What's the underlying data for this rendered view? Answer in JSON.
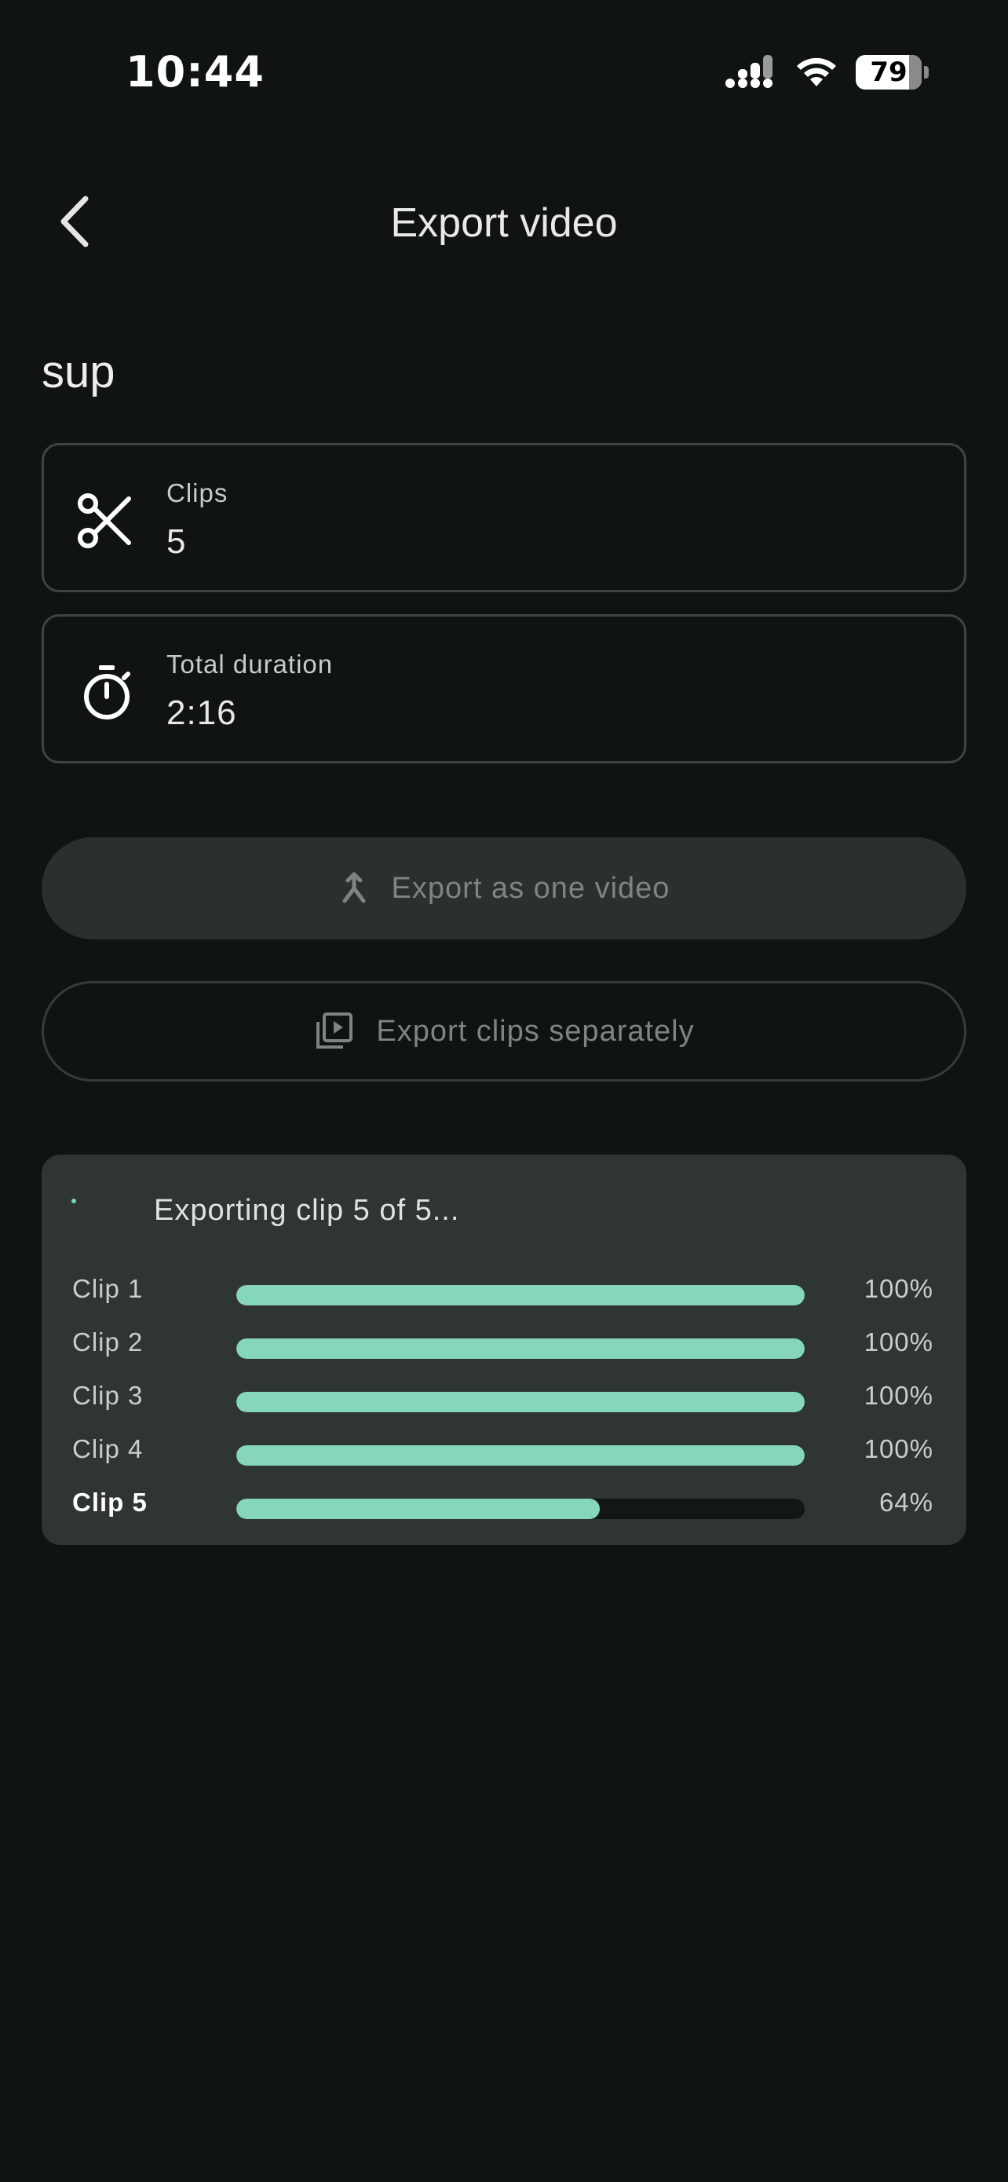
{
  "status_bar": {
    "time": "10:44",
    "battery": "79"
  },
  "app_bar": {
    "title": "Export video"
  },
  "project": {
    "name": "sup"
  },
  "info_cards": {
    "clips": {
      "label": "Clips",
      "value": "5",
      "icon": "scissors-icon"
    },
    "duration": {
      "label": "Total duration",
      "value": "2:16",
      "icon": "timer-icon"
    }
  },
  "actions": {
    "export_one": {
      "label": "Export as one video",
      "icon": "merge-icon"
    },
    "export_separate": {
      "label": "Export clips separately",
      "icon": "video-library-icon"
    }
  },
  "progress": {
    "status": "Exporting clip 5 of 5...",
    "clips": [
      {
        "label": "Clip 1",
        "percent_text": "100%",
        "fraction": 1.0
      },
      {
        "label": "Clip 2",
        "percent_text": "100%",
        "fraction": 1.0
      },
      {
        "label": "Clip 3",
        "percent_text": "100%",
        "fraction": 1.0
      },
      {
        "label": "Clip 4",
        "percent_text": "100%",
        "fraction": 1.0
      },
      {
        "label": "Clip 5",
        "percent_text": "64%",
        "fraction": 0.64
      }
    ]
  },
  "colors": {
    "background": "#0f1413",
    "accent": "#86d6bd",
    "panel": "#2f3534"
  }
}
